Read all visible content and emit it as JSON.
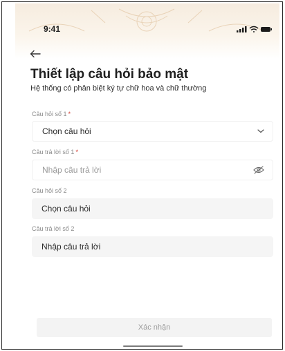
{
  "status_bar": {
    "time": "9:41"
  },
  "page": {
    "title": "Thiết lập câu hỏi bảo mật",
    "subtitle": "Hệ thống có phân biệt ký tự chữ hoa và chữ thường"
  },
  "fields": [
    {
      "label": "Câu hỏi số 1",
      "required": "*",
      "value": "Chọn câu hỏi",
      "icon": "chevron-down-icon"
    },
    {
      "label": "Câu trả lời số 1",
      "required": "*",
      "placeholder": "Nhập câu trả lời",
      "icon": "eye-off-icon"
    },
    {
      "label": "Câu hỏi số 2",
      "value": "Chọn câu hỏi"
    },
    {
      "label": "Câu trả lời số 2",
      "placeholder": "Nhập câu trả lời"
    }
  ],
  "confirm_button": {
    "label": "Xác nhận"
  },
  "colors": {
    "required": "#d0362b",
    "header_tint": "#f6ecdf",
    "disabled_text": "#9c9c9c"
  }
}
